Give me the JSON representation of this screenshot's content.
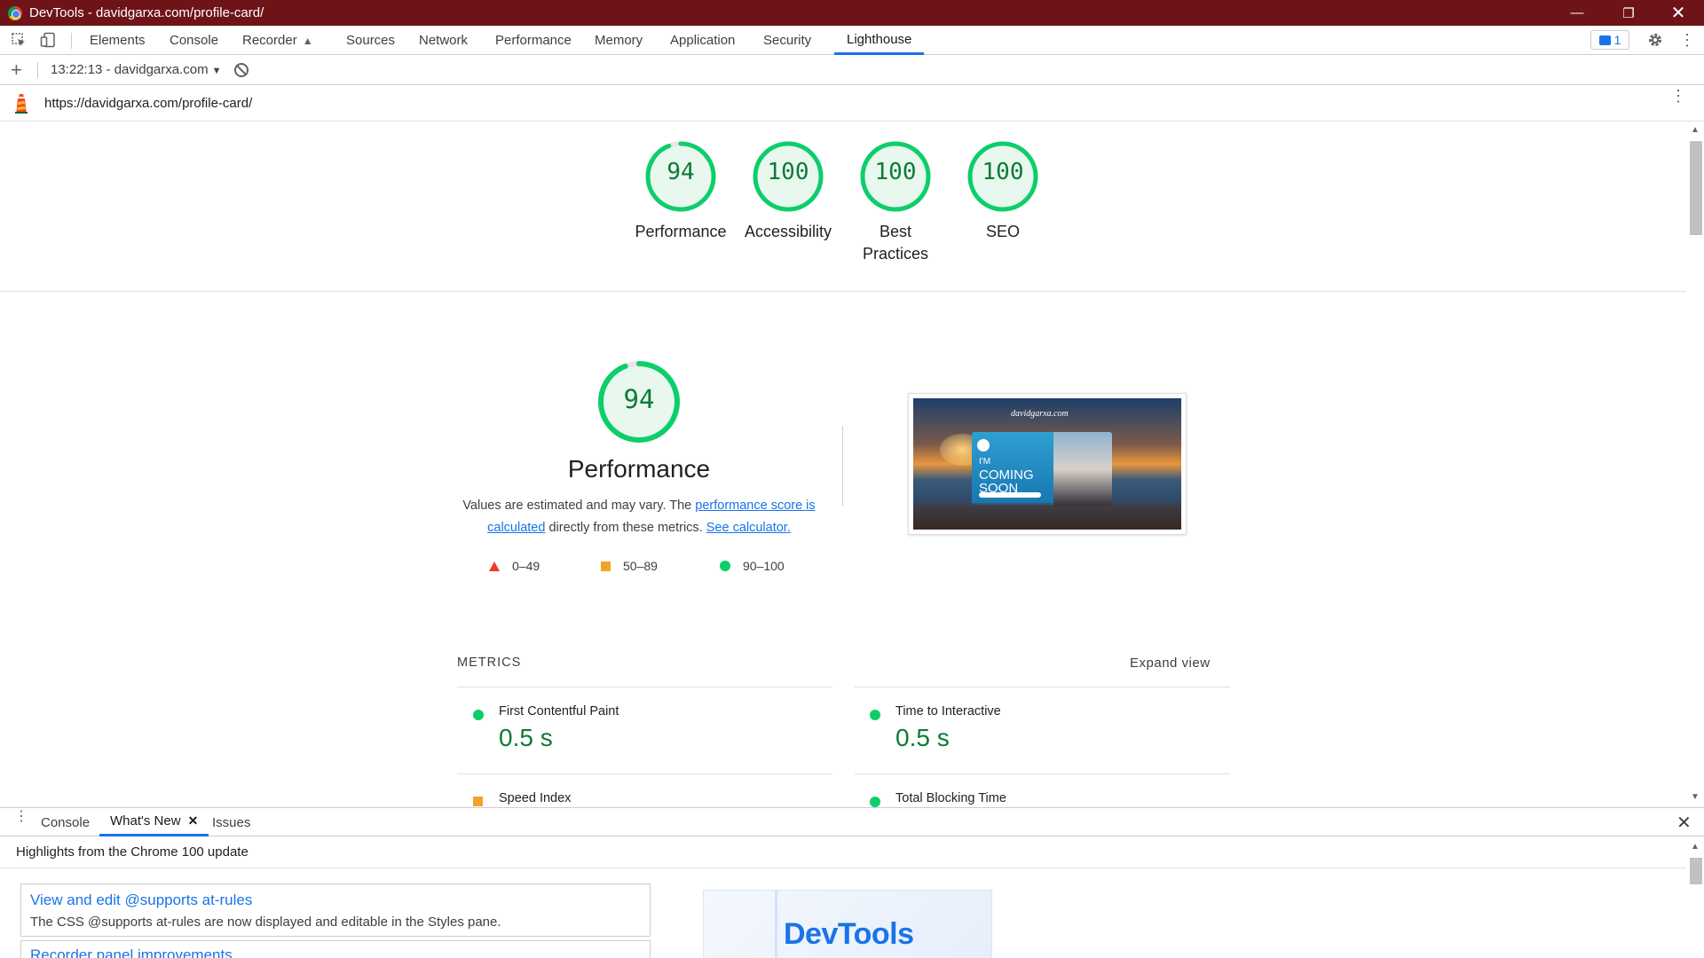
{
  "window": {
    "title": "DevTools - davidgarxa.com/profile-card/"
  },
  "devtools_tabs": [
    {
      "label": "Elements"
    },
    {
      "label": "Console"
    },
    {
      "label": "Recorder"
    },
    {
      "label": "Sources"
    },
    {
      "label": "Network"
    },
    {
      "label": "Performance"
    },
    {
      "label": "Memory"
    },
    {
      "label": "Application"
    },
    {
      "label": "Security"
    },
    {
      "label": "Lighthouse",
      "active": true
    }
  ],
  "issues_badge": "1",
  "lighthouse_toolbar": {
    "report_select": "13:22:13 - davidgarxa.com"
  },
  "url_bar": {
    "url": "https://davidgarxa.com/profile-card/"
  },
  "summary_gauges": [
    {
      "score": "94",
      "label": "Performance",
      "score_value": 94
    },
    {
      "score": "100",
      "label": "Accessibility",
      "score_value": 100
    },
    {
      "score": "100",
      "label": "Best Practices",
      "score_value": 100
    },
    {
      "score": "100",
      "label": "SEO",
      "score_value": 100
    }
  ],
  "performance": {
    "score": "94",
    "score_value": 94,
    "title": "Performance",
    "desc_prefix": "Values are estimated and may vary. The ",
    "link_score": "performance score is calculated",
    "desc_middle": " directly from these metrics. ",
    "link_calculator": "See calculator.",
    "legend": [
      {
        "range": "0–49",
        "marker": "red-triangle"
      },
      {
        "range": "50–89",
        "marker": "orange-square"
      },
      {
        "range": "90–100",
        "marker": "green-circle"
      }
    ],
    "screenshot": {
      "brand_text": "davidgarxa.com",
      "card_text_1": "I'M",
      "card_text_2": "COMING",
      "card_text_3": "SOON"
    }
  },
  "metrics": {
    "header": "METRICS",
    "expand": "Expand view",
    "items": [
      {
        "name": "First Contentful Paint",
        "value": "0.5 s",
        "marker": "green-circle"
      },
      {
        "name": "Time to Interactive",
        "value": "0.5 s",
        "marker": "green-circle"
      },
      {
        "name": "Speed Index",
        "value": "",
        "marker": "orange-square"
      },
      {
        "name": "Total Blocking Time",
        "value": "",
        "marker": "green-circle"
      }
    ]
  },
  "drawer": {
    "tabs": [
      {
        "label": "Console"
      },
      {
        "label": "What's New",
        "active": true
      },
      {
        "label": "Issues"
      }
    ],
    "highlights": "Highlights from the Chrome 100 update",
    "cards": [
      {
        "title": "View and edit @supports at-rules",
        "desc": "The CSS @supports at-rules are now displayed and editable in the Styles pane."
      },
      {
        "title": "Recorder panel improvements"
      }
    ],
    "promo_text": "DevTools"
  },
  "colors": {
    "titlebar": "#6e1419",
    "accent": "#1a73e8",
    "pass": "#0cce6b",
    "pass_text": "#0c7b34",
    "average": "#f4a32a",
    "fail": "#eb3b2e"
  }
}
